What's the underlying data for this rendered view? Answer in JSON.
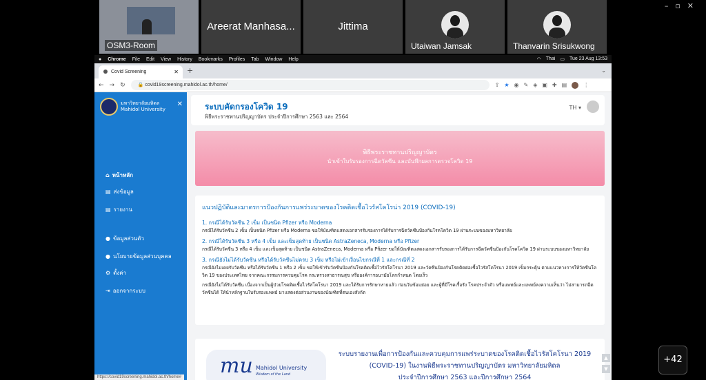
{
  "participants": [
    {
      "name": "OSM3-Room"
    },
    {
      "name": "Areerat Manhasa..."
    },
    {
      "name": "Jittima"
    },
    {
      "name": "Utaiwan Jamsak"
    },
    {
      "name": "Thanvarin Srisukwong"
    }
  ],
  "more_participants": "+42",
  "mac_menu": [
    "Chrome",
    "File",
    "Edit",
    "View",
    "History",
    "Bookmarks",
    "Profiles",
    "Tab",
    "Window",
    "Help"
  ],
  "mac_status": {
    "input_lang": "Thai",
    "datetime": "Tue 23 Aug  13:53"
  },
  "browser": {
    "tab_title": "Covid Screening",
    "url": "covid19screening.mahidol.ac.th/home/",
    "status_url": "https://covid19screening.mahidol.ac.th/home#"
  },
  "sidebar": {
    "brand_th": "มหาวิทยาลัยมหิดล",
    "brand_en": "Mahidol University",
    "items": [
      {
        "label": "หน้าหลัก",
        "icon": "home-icon"
      },
      {
        "label": "ส่งข้อมูล",
        "icon": "file-icon"
      },
      {
        "label": "รายงาน",
        "icon": "file-icon"
      },
      {
        "label": "ข้อมูลส่วนตัว",
        "icon": "user-icon"
      },
      {
        "label": "นโยบายข้อมูลส่วนบุคคล",
        "icon": "user-shield-icon"
      },
      {
        "label": "ตั้งค่า",
        "icon": "gear-icon"
      },
      {
        "label": "ออกจากระบบ",
        "icon": "logout-icon"
      }
    ]
  },
  "header": {
    "title": "ระบบคัดกรองโควิด 19",
    "subtitle": "พิธีพระราชทานปริญญาบัตร ประจำปีการศึกษา 2563 และ 2564",
    "lang": "TH ▾"
  },
  "banner": {
    "title": "พิธีพระราชทานปริญญาบัตร",
    "subtitle": "นำเข้าใบรับรองการฉีดวัคซีน และบันทึกผลการตรวจโควิด 19"
  },
  "guidelines": {
    "title": "แนวปฏิบัติและมาตรการป้องกันการแพร่ระบาดของโรคติดเชื้อไวรัสโคโรน่า 2019 (COVID-19)",
    "cases": [
      {
        "title": "1. กรณีได้รับวัคซีน 2 เข็ม เป็นชนิด Pfizer หรือ Moderna",
        "body": "กรณีได้รับวัคซีน 2 เข็ม เป็นชนิด Pfizer หรือ Moderna ขอให้บัณฑิตแสดงเอกสารรับรองการได้รับการฉีดวัคซีนป้องกันโรคโควิด 19 ผ่านระบบของมหาวิทยาลัย"
      },
      {
        "title": "2. กรณีได้รับวัคซีน 3 หรือ 4 เข็ม และเข็มสุดท้าย เป็นชนิด AstraZeneca, Moderna หรือ Pfizer",
        "body": "กรณีได้รับวัคซีน 3 หรือ 4 เข็ม และเข็มสุดท้าย เป็นชนิด AstraZeneca, Moderna หรือ Pfizer ขอให้บัณฑิตแสดงเอกสารรับรองการได้รับการฉีดวัคซีนป้องกันโรคโควิด 19 ผ่านระบบของมหาวิทยาลัย"
      },
      {
        "title": "3. กรณียังไม่ได้รับวัคซีน หรือได้รับวัคซีนไม่ครบ 3 เข็ม หรือไม่เข้าเงื่อนไขกรณีที่ 1 และกรณีที่ 2",
        "body": "กรณียังไม่เคยรับวัคซีน หรือได้รับวัคซีน 1 หรือ 2 เข็ม ขอให้เข้ารับวัคซีนป้องกันโรคติดเชื้อไวรัสโคโรนา 2019 และวัคซีนป้องกันโรคติดต่อเชื้อไวรัสโคโรนา 2019 เข็มกระตุ้น ตามแนวทางการให้วัคซีนโควิด 19 ของประเทศไทย จากคณะกรรมการควบคุมโรค กระทรวงสาธารณสุข หรือองค์การอนามัยโลกกำหนด โดยเร็ว",
        "body2": "กรณียังไม่ได้รับวัคซีน เนื่องจากเป็นผู้ป่วยโรคติดเชื้อไวรัสโคโรนา 2019 และได้รับการรักษาหายแล้ว ก่อนวันซ้อมย่อย และผู้ที่มีโรคเรื้อรัง โรคประจำตัว หรือแพทย์และแพทย์ลงความเห็นว่า ไม่สามารถฉีดวัคซีนได้ ให้นำหลักฐานใบรับรองแพทย์ มาแสดงต่อส่วนงานของบัณฑิตที่ตนเองสังกัด"
      }
    ]
  },
  "footer": {
    "logo_name": "Mahidol University",
    "logo_tag": "Wisdom of the Land",
    "text1": "ระบบรายงานเพื่อการป้องกันและควบคุมการแพร่ระบาดของโรคติดเชื้อไวรัสโคโรนา 2019",
    "text2": "(COVID-19) ในงานพิธีพระราชทานปริญญาบัตร มหาวิทยาลัยมหิดล",
    "text3": "ประจำปีการศึกษา 2563 และปีการศึกษา 2564"
  }
}
